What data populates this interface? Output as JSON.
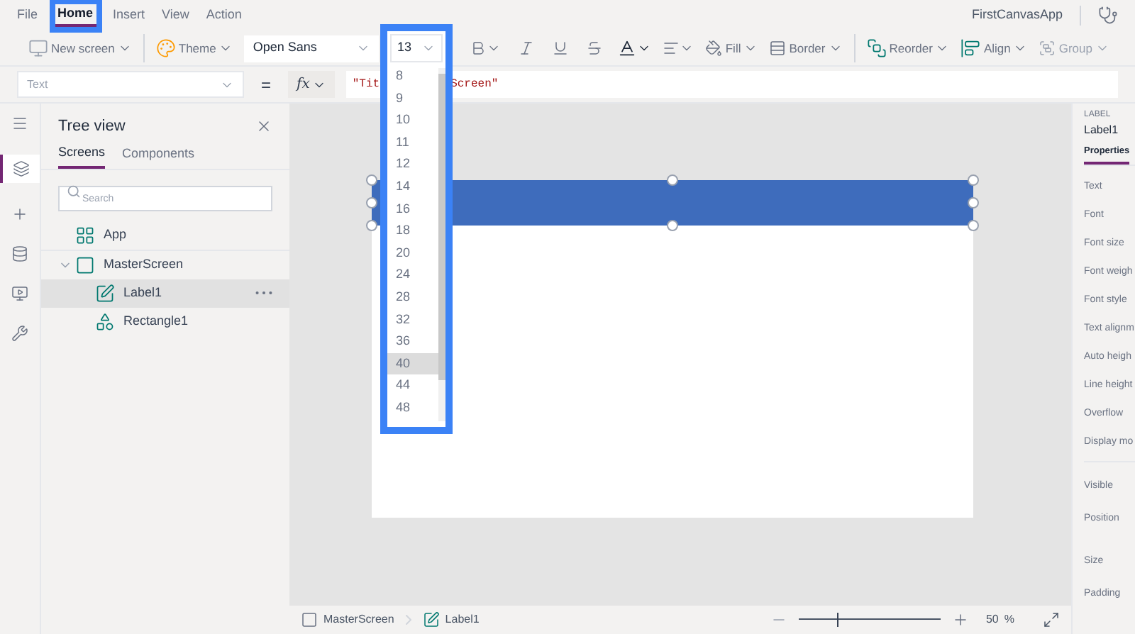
{
  "menu": [
    {
      "label": "File",
      "selected": false
    },
    {
      "label": "Home",
      "selected": true
    },
    {
      "label": "Insert",
      "selected": false
    },
    {
      "label": "View",
      "selected": false
    },
    {
      "label": "Action",
      "selected": false
    }
  ],
  "app_name": "FirstCanvasApp",
  "toolbar": {
    "new_screen": "New screen",
    "theme": "Theme",
    "font": "Open Sans",
    "font_size": "13",
    "fill": "Fill",
    "border": "Border",
    "reorder": "Reorder",
    "align": "Align",
    "group": {
      "label": "Group",
      "disabled": true
    }
  },
  "formula_bar": {
    "property": "Text",
    "equals": "=",
    "fx": "fx",
    "formula_start": "\"Tit",
    "formula_end": "Screen\""
  },
  "font_size_dropdown": [
    {
      "label": "8",
      "selected": false
    },
    {
      "label": "9",
      "selected": false
    },
    {
      "label": "10",
      "selected": false
    },
    {
      "label": "11",
      "selected": false
    },
    {
      "label": "12",
      "selected": false
    },
    {
      "label": "14",
      "selected": false
    },
    {
      "label": "16",
      "selected": false
    },
    {
      "label": "18",
      "selected": false
    },
    {
      "label": "20",
      "selected": false
    },
    {
      "label": "24",
      "selected": false
    },
    {
      "label": "28",
      "selected": false
    },
    {
      "label": "32",
      "selected": false
    },
    {
      "label": "36",
      "selected": false
    },
    {
      "label": "40",
      "selected": true
    },
    {
      "label": "44",
      "selected": false
    },
    {
      "label": "48",
      "selected": false
    }
  ],
  "tree_view": {
    "title": "Tree view",
    "tabs": [
      {
        "label": "Screens",
        "selected": true
      },
      {
        "label": "Components",
        "selected": false
      }
    ],
    "search": {
      "placeholder": "Search"
    },
    "items": [
      {
        "label": "App",
        "kind": "app",
        "selected": false
      },
      {
        "label": "MasterScreen",
        "kind": "screen",
        "selected": false,
        "expanded": true,
        "children": [
          {
            "label": "Label1",
            "kind": "label",
            "selected": true
          },
          {
            "label": "Rectangle1",
            "kind": "shape",
            "selected": false
          }
        ]
      }
    ]
  },
  "properties_panel": {
    "type": "LABEL",
    "name": "Label1",
    "tabs": [
      {
        "label": "Properties",
        "selected": true
      }
    ],
    "rows": [
      "Text",
      "Font",
      "Font size",
      "Font weigh",
      "Font style",
      "Text alignm",
      "Auto heigh",
      "Line height",
      "Overflow",
      "Display mo"
    ],
    "rows_2": [
      "Visible",
      "Position",
      "Size",
      "Padding"
    ]
  },
  "status_bar": {
    "screen": "MasterScreen",
    "control": "Label1",
    "zoom": {
      "level": 0.27,
      "value": "50",
      "unit": "%"
    }
  }
}
